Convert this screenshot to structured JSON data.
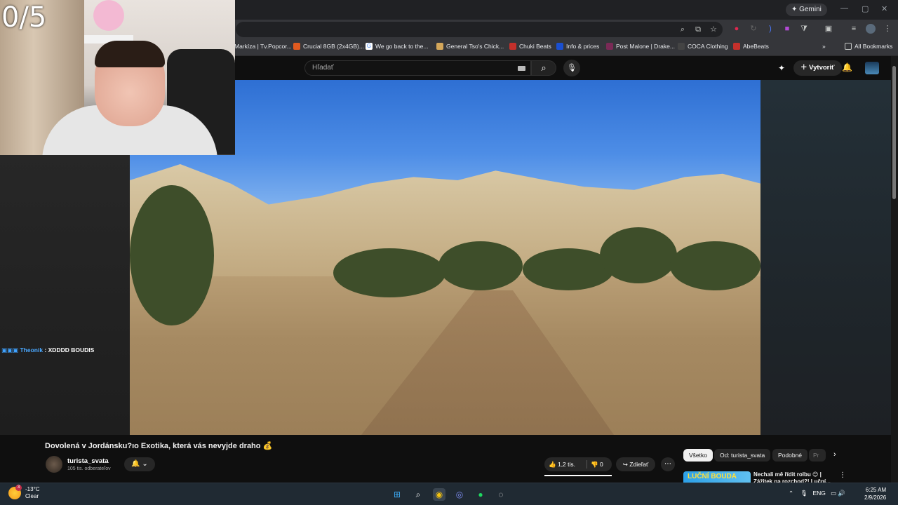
{
  "webcam": {
    "counter": "0/5"
  },
  "browser": {
    "gemini_label": "Gemini",
    "bookmarks": [
      {
        "label": "Markíza | Tv.Popcor...",
        "color": "#1e5aa8"
      },
      {
        "label": "Crucial 8GB (2x4GB)...",
        "color": "#e05a1f"
      },
      {
        "label": "We go back to the...",
        "color": "#4285f4"
      },
      {
        "label": "General Tso's Chick...",
        "color": "#d4a75a"
      },
      {
        "label": "Chuki Beats",
        "color": "#c4302b"
      },
      {
        "label": "Info & prices",
        "color": "#1a4fd0"
      },
      {
        "label": "Post Malone | Drake...",
        "color": "#7a2a56"
      },
      {
        "label": "COCA Clothing",
        "color": "#222222"
      },
      {
        "label": "AbeBeats",
        "color": "#c4302b"
      }
    ],
    "all_bookmarks": "All Bookmarks"
  },
  "youtube": {
    "search_placeholder": "Hľadať",
    "create_label": "Vytvoriť"
  },
  "chat": {
    "user": "Theonik",
    "separator": " : ",
    "message": "XDDDD BOUDIS"
  },
  "video": {
    "title": "Dovolená v Jordánsku?ıo Exotika, která vás nevyjde draho 💰",
    "channel": "turista_svata",
    "subscribers": "105 tis. odberateľov",
    "likes": "1,2 tis.",
    "dislikes": "0",
    "share_label": "Zdieľať"
  },
  "chips": [
    "Všetko",
    "Od: turista_svata",
    "Podobné",
    "Pr"
  ],
  "recommendation": {
    "thumb_text": "LUČNÍ BOUDA",
    "title": "Nechali mě řídit rolbu 😊 | Zážitek na rozchod?! Luční..."
  },
  "taskbar": {
    "temperature": "-13°C",
    "condition": "Clear",
    "weather_badge": "3",
    "language": "ENG",
    "time": "6:25 AM",
    "date": "2/9/2026"
  }
}
